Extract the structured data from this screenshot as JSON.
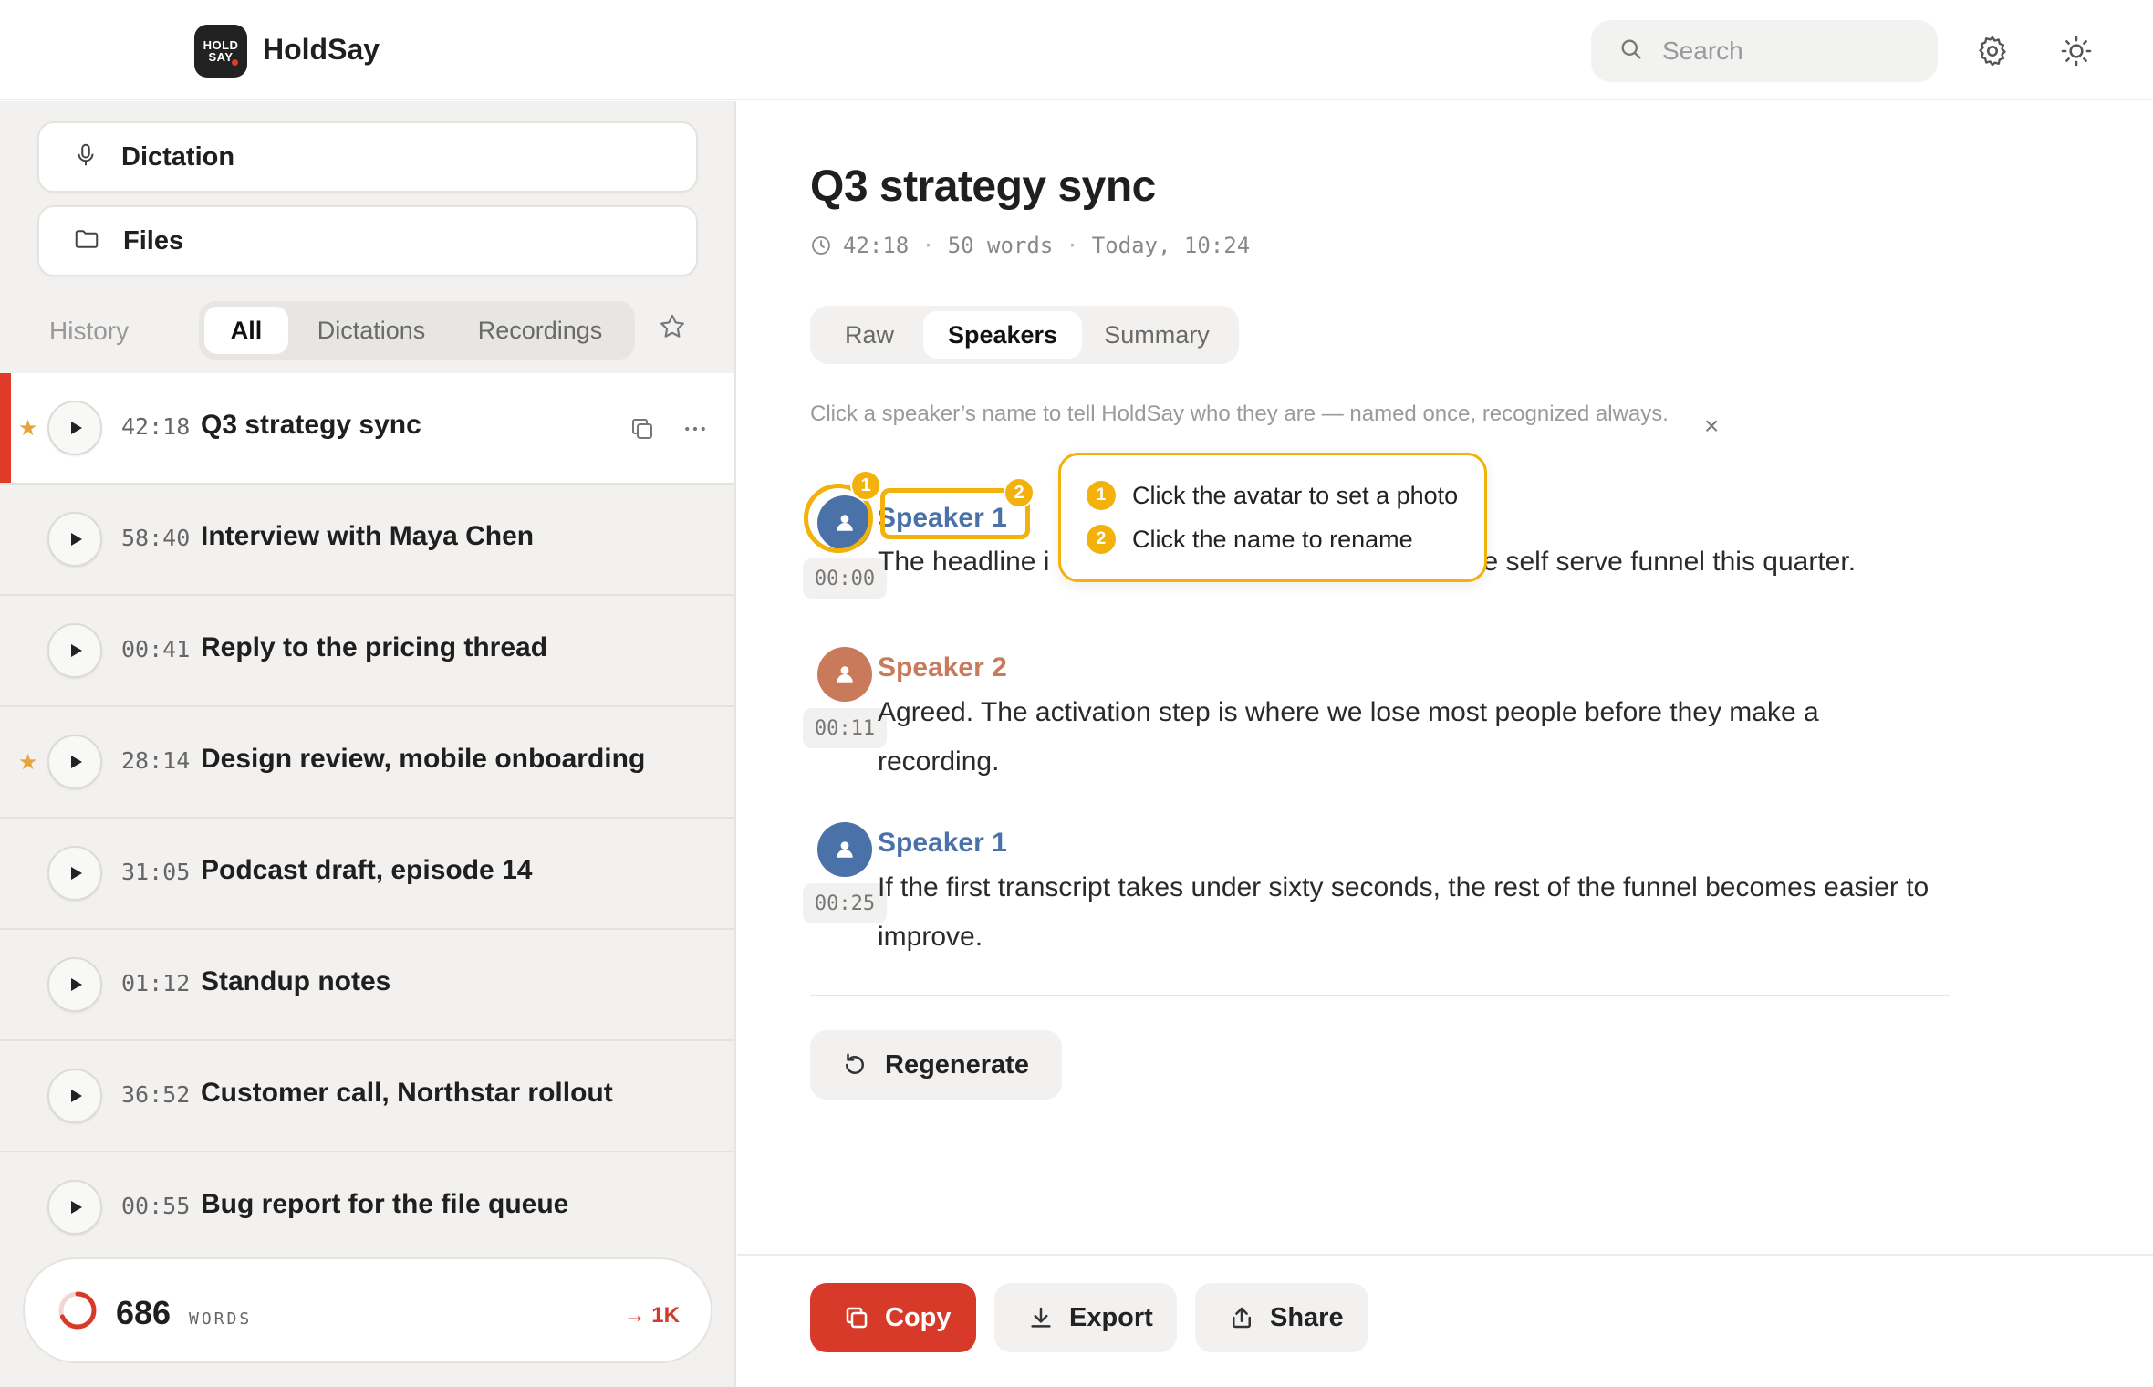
{
  "app": {
    "logo_line1": "HOLD",
    "logo_line2": "SAY",
    "title": "HoldSay"
  },
  "header": {
    "search_placeholder": "Search",
    "icons": [
      "search-icon",
      "gear-icon",
      "sun-icon"
    ]
  },
  "sidebar": {
    "nav": [
      {
        "label": "Dictation",
        "icon": "microphone-icon"
      },
      {
        "label": "Files",
        "icon": "folder-icon"
      }
    ],
    "history_label": "History",
    "filters": [
      {
        "label": "All",
        "active": true
      },
      {
        "label": "Dictations",
        "active": false
      },
      {
        "label": "Recordings",
        "active": false
      }
    ],
    "items": [
      {
        "duration": "42:18",
        "title": "Q3 strategy sync",
        "starred": true,
        "active": true
      },
      {
        "duration": "58:40",
        "title": "Interview with Maya Chen",
        "starred": false,
        "active": false
      },
      {
        "duration": "00:41",
        "title": "Reply to the pricing thread",
        "starred": false,
        "active": false
      },
      {
        "duration": "28:14",
        "title": "Design review, mobile onboarding",
        "starred": true,
        "active": false
      },
      {
        "duration": "31:05",
        "title": "Podcast draft, episode 14",
        "starred": false,
        "active": false
      },
      {
        "duration": "01:12",
        "title": "Standup notes",
        "starred": false,
        "active": false
      },
      {
        "duration": "36:52",
        "title": "Customer call, Northstar rollout",
        "starred": false,
        "active": false
      },
      {
        "duration": "00:55",
        "title": "Bug report for the file queue",
        "starred": false,
        "active": false
      }
    ],
    "words": {
      "count": "686",
      "unit": "WORDS",
      "goal": "→ 1K",
      "progress": 0.686
    }
  },
  "main": {
    "title": "Q3 strategy sync",
    "meta": {
      "duration": "42:18",
      "words": "50 words",
      "date": "Today, 10:24"
    },
    "tabs": [
      {
        "label": "Raw",
        "active": false
      },
      {
        "label": "Speakers",
        "active": true
      },
      {
        "label": "Summary",
        "active": false
      }
    ],
    "hint": "Click a speaker’s name to tell HoldSay who they are — named once, recognized always.",
    "hint_close": "×",
    "segments": [
      {
        "speaker": "Speaker 1",
        "color": "#4a72a8",
        "time": "00:00",
        "text_start": "The headline i",
        "text_end": "e self serve funnel this quarter."
      },
      {
        "speaker": "Speaker 2",
        "color": "#c97a5a",
        "time": "00:11",
        "text": "Agreed. The activation step is where we lose most people before they make a recording."
      },
      {
        "speaker": "Speaker 1",
        "color": "#4a72a8",
        "time": "00:25",
        "text": "If the first transcript takes under sixty seconds, the rest of the funnel becomes easier to improve."
      }
    ],
    "tooltip": {
      "badge1": "1",
      "badge2": "2",
      "line1": "Click the avatar to set a photo",
      "line2": "Click the name to rename"
    },
    "regenerate": "Regenerate",
    "footer": {
      "copy": "Copy",
      "export": "Export",
      "share": "Share"
    }
  },
  "colors": {
    "accent": "#d83a2a",
    "highlight": "#f2b10b",
    "speaker1": "#4a72a8",
    "speaker2": "#c97a5a",
    "star": "#e8a33d"
  }
}
